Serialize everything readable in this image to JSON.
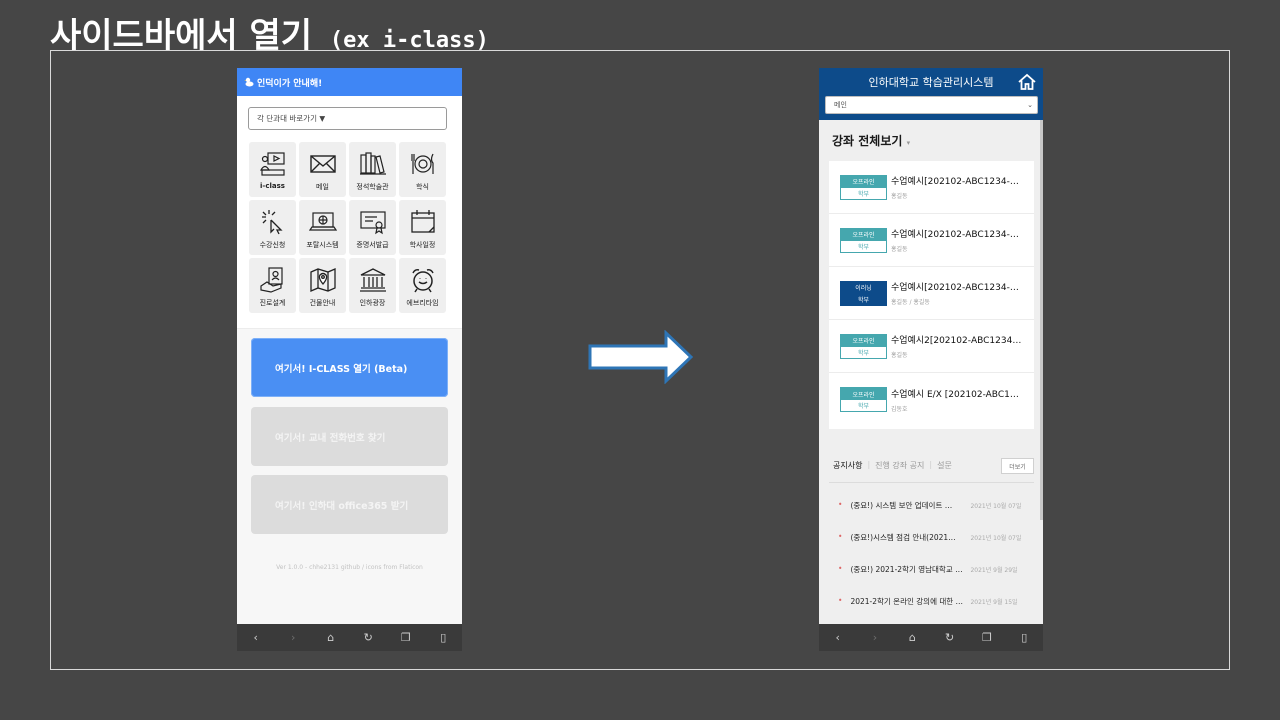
{
  "slide": {
    "title": "사이드바에서 열기",
    "subtitle": "(ex i-class)"
  },
  "left_phone": {
    "header_title": "인덕이가 안내해!",
    "college_select": "각 단과대 바로가기 ▼",
    "grid": [
      {
        "label": "i-class",
        "icon": "lecture-video-icon"
      },
      {
        "label": "메일",
        "icon": "mail-icon"
      },
      {
        "label": "정석학술관",
        "icon": "books-icon"
      },
      {
        "label": "학식",
        "icon": "meal-icon"
      },
      {
        "label": "수강신청",
        "icon": "click-cursor-icon"
      },
      {
        "label": "포탈시스템",
        "icon": "laptop-globe-icon"
      },
      {
        "label": "증명서발급",
        "icon": "certificate-icon"
      },
      {
        "label": "학사일정",
        "icon": "calendar-icon"
      },
      {
        "label": "진로설계",
        "icon": "career-icon"
      },
      {
        "label": "건물안내",
        "icon": "map-pin-icon"
      },
      {
        "label": "인하광장",
        "icon": "building-icon"
      },
      {
        "label": "에브리타임",
        "icon": "alarm-clock-icon"
      }
    ],
    "buttons": {
      "iclass": "여기서! I-CLASS 열기 (Beta)",
      "phone": "여기서! 교내 전화번호 찾기",
      "office": "여기서! 인하대 office365 받기"
    },
    "footer": "Ver 1.0.0 - chhe2131 github / icons from Flaticon"
  },
  "right_phone": {
    "header_title": "인하대학교 학습관리시스템",
    "menu_select": "메인",
    "section_title": "강좌 전체보기",
    "courses": [
      {
        "type": "오프라인",
        "level": "학부",
        "name": "수업예시[202102-ABC1234-…",
        "prof": "홍길동"
      },
      {
        "type": "오프라인",
        "level": "학부",
        "name": "수업예시[202102-ABC1234-…",
        "prof": "홍길동"
      },
      {
        "type": "이러닝",
        "level": "학부",
        "name": "수업예시[202102-ABC1234-…",
        "prof": "홍길동 / 홍길동"
      },
      {
        "type": "오프라인",
        "level": "학부",
        "name": "수업예시2[202102-ABC1234…",
        "prof": "홍길동"
      },
      {
        "type": "오프라인",
        "level": "학부",
        "name": "수업예시 E/X [202102-ABC1…",
        "prof": "김동호"
      }
    ],
    "tabs": [
      "공지사항",
      "진행 강좌 공지",
      "설문"
    ],
    "more": "더보기",
    "notices": [
      {
        "title": "(중요!) 시스템 보안 업데이트 …",
        "date": "2021년 10월 07일"
      },
      {
        "title": "(중요!)시스템 점검 안내(2021…",
        "date": "2021년 10월 07일"
      },
      {
        "title": "(중요!) 2021-2학기 영남대학교 …",
        "date": "2021년 9월 29일"
      },
      {
        "title": "2021-2학기 온라인 강의에 대한 …",
        "date": "2021년 9월 15일"
      }
    ]
  }
}
